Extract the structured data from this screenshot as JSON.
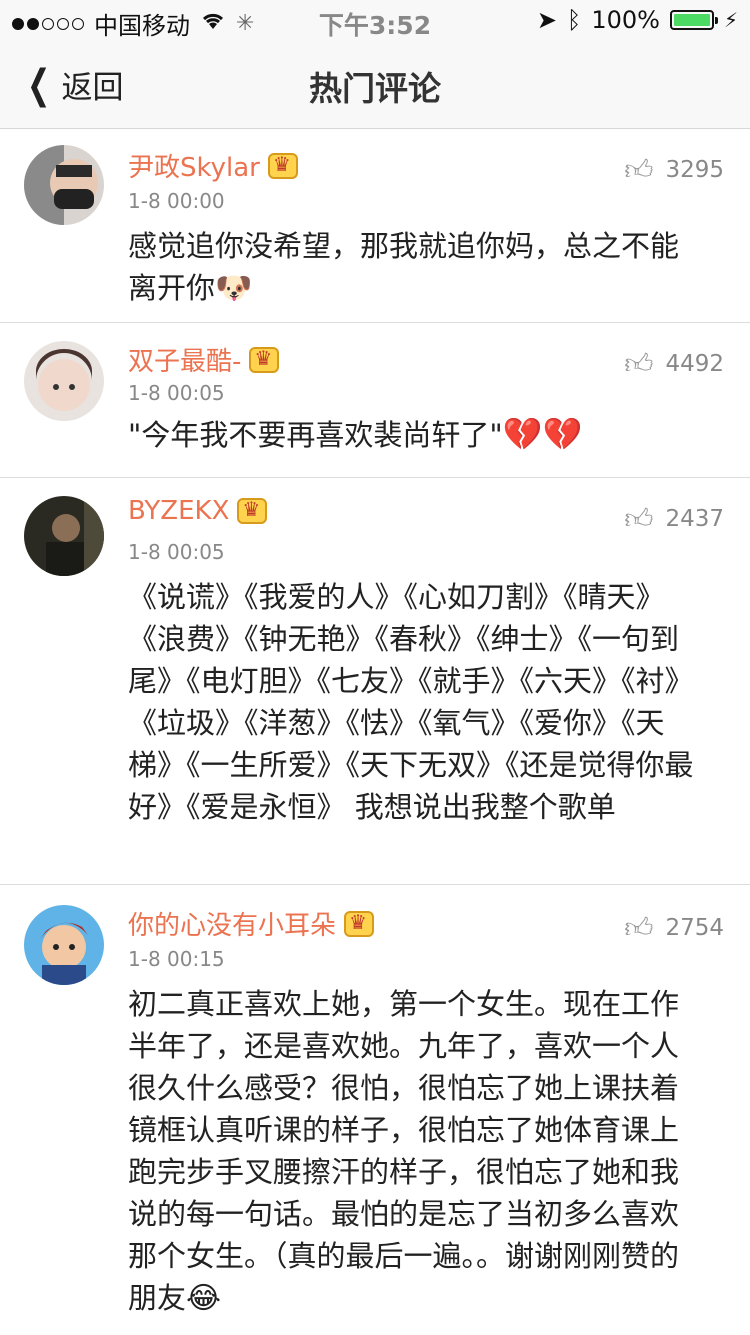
{
  "status_bar": {
    "carrier": "中国移动",
    "time": "下午3:52",
    "battery": "100%"
  },
  "nav": {
    "back_label": "返回",
    "title": "热门评论"
  },
  "comments": [
    {
      "username": "尹政Skylar",
      "time": "1-8 00:00",
      "likes": "3295",
      "text": "感觉追你没希望，那我就追你妈，总之不能离开你",
      "emoji": "🐶"
    },
    {
      "username": "双子最酷-",
      "time": "1-8 00:05",
      "likes": "4492",
      "text": "\"今年我不要再喜欢裴尚轩了\"",
      "emoji": "💔💔"
    },
    {
      "username": "BYZEKX",
      "time": "1-8 00:05",
      "likes": "2437",
      "text": "《说谎》《我爱的人》《心如刀割》《晴天》《浪费》《钟无艳》《春秋》《绅士》《一句到尾》《电灯胆》《七友》《就手》《六天》《衬》《垃圾》《洋葱》《怯》《氧气》《爱你》《天梯》《一生所爱》《天下无双》《还是觉得你最好》《爱是永恒》 我想说出我整个歌单",
      "emoji": ""
    },
    {
      "username": "你的心没有小耳朵",
      "time": "1-8 00:15",
      "likes": "2754",
      "text": "初二真正喜欢上她，第一个女生。现在工作半年了，还是喜欢她。九年了，喜欢一个人很久什么感受？很怕，很怕忘了她上课扶着镜框认真听课的样子，很怕忘了她体育课上跑完步手叉腰擦汗的样子，很怕忘了她和我说的每一句话。最怕的是忘了当初多么喜欢那个女生。（真的最后一遍。。谢谢刚刚赞的朋友",
      "emoji": "😂"
    }
  ]
}
